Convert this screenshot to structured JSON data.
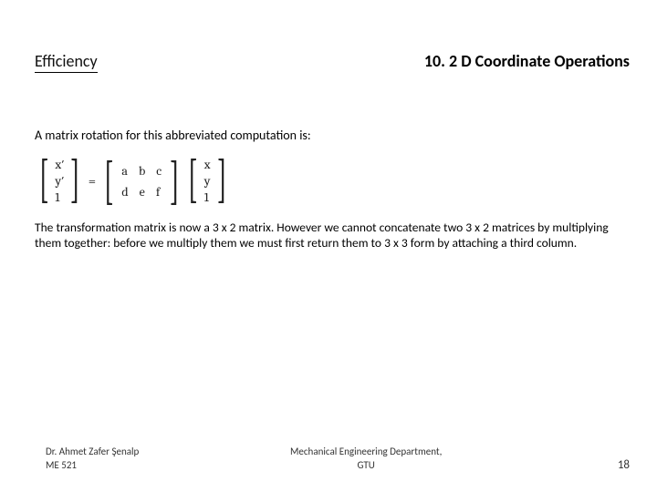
{
  "header": {
    "left": "Efficiency",
    "right": "10. 2 D Coordinate Operations"
  },
  "intro": "A matrix rotation for this abbreviated computation is:",
  "eq": {
    "lhs": [
      "x′",
      "y′",
      "1"
    ],
    "mat": {
      "r1": [
        "a",
        "b",
        "c"
      ],
      "r2": [
        "d",
        "e",
        "f"
      ]
    },
    "rhs": [
      "x",
      "y",
      "1"
    ],
    "eqsign": "="
  },
  "body": "The transformation matrix is now a 3 x 2 matrix. However we cannot concatenate two   3 x 2 matrices by multiplying them together: before we multiply them we must first return them to 3 x 3 form by attaching a third column.",
  "footer": {
    "author": "Dr. Ahmet Zafer Şenalp",
    "course": "ME 521",
    "dept": "Mechanical Engineering Department,",
    "uni": "GTU",
    "page": "18"
  }
}
